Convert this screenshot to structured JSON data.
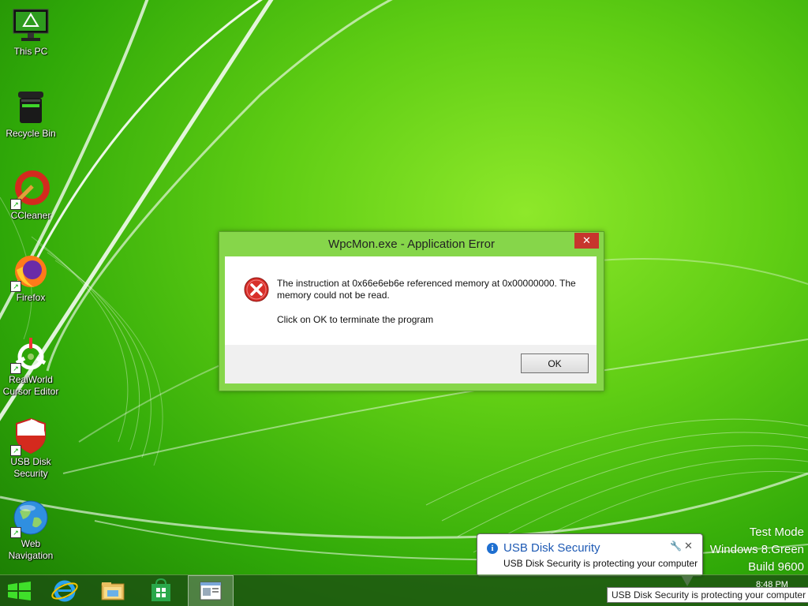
{
  "desktop": {
    "icons": [
      {
        "label_lines": [
          "This PC"
        ],
        "icon": "monitor-icon"
      },
      {
        "label_lines": [
          "Recycle Bin"
        ],
        "icon": "recycle-bin-icon"
      },
      {
        "label_lines": [
          "CCleaner"
        ],
        "icon": "ccleaner-icon"
      },
      {
        "label_lines": [
          "Firefox"
        ],
        "icon": "firefox-icon"
      },
      {
        "label_lines": [
          "RealWorld",
          "Cursor Editor"
        ],
        "icon": "realworld-cursor-editor-icon"
      },
      {
        "label_lines": [
          "USB Disk",
          "Security"
        ],
        "icon": "usb-disk-security-shield-icon"
      },
      {
        "label_lines": [
          "Web",
          "Navigation"
        ],
        "icon": "globe-icon"
      }
    ],
    "watermark": {
      "line1": "Test Mode",
      "line2": "Windows 8.Green",
      "line3": "Build 9600"
    }
  },
  "dialog": {
    "title": "WpcMon.exe - Application Error",
    "close_label": "✕",
    "message_line1": "The instruction at 0x66e6eb6e referenced memory at 0x00000000. The",
    "message_line2": "memory could not be read.",
    "message_secondary": "Click on OK to terminate the program",
    "ok_label": "OK",
    "icon": "error-icon"
  },
  "balloon": {
    "title": "USB Disk Security",
    "text": "USB Disk Security is protecting your computer",
    "info_glyph": "i",
    "wrench_glyph": "🔧",
    "close_glyph": "✕"
  },
  "taskbar": {
    "buttons": [
      "start-button",
      "internet-explorer",
      "file-explorer",
      "windows-store",
      "active-window"
    ],
    "clock_time": "8:48 PM",
    "tooltip": "USB Disk Security is protecting your computer"
  },
  "colors": {
    "dialog_frame": "#86d64a",
    "close_button": "#c7352d",
    "balloon_title": "#1e5ab4",
    "taskbar": "#1c4e12"
  }
}
